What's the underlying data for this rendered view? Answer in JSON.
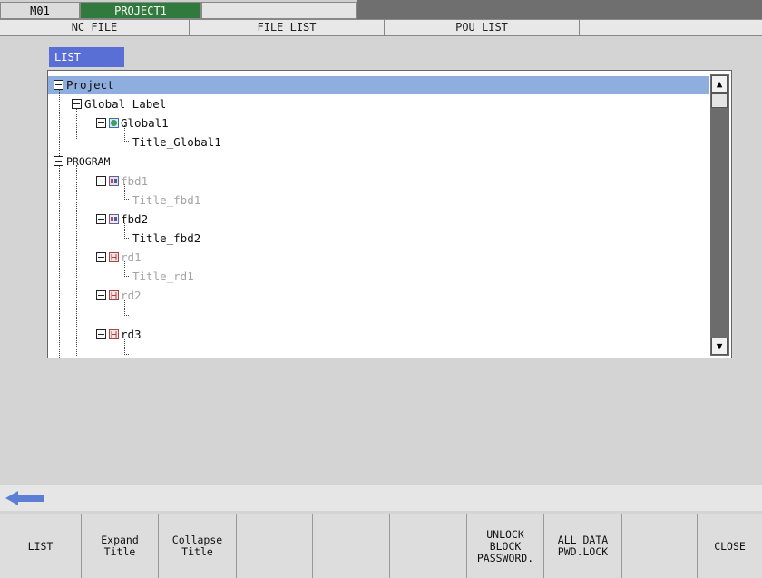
{
  "header": {
    "machine": "M01",
    "project": "PROJECT1"
  },
  "tabs": [
    "NC FILE",
    "FILE LIST",
    "POU LIST"
  ],
  "list_label": "LIST",
  "tree": [
    {
      "label": "Project"
    },
    {
      "label": "Global Label"
    },
    {
      "label": "Global1"
    },
    {
      "label": "Title_Global1"
    },
    {
      "label": "PROGRAM"
    },
    {
      "label": "fbd1"
    },
    {
      "label": "Title_fbd1"
    },
    {
      "label": "fbd2"
    },
    {
      "label": "Title_fbd2"
    },
    {
      "label": "rd1"
    },
    {
      "label": "Title_rd1"
    },
    {
      "label": "rd2"
    },
    {
      "label": "rd3"
    }
  ],
  "scroll": {
    "up": "▲",
    "down": "▼"
  },
  "fkeys": [
    "LIST",
    "Expand\nTitle",
    "Collapse\nTitle",
    "",
    "",
    "",
    "UNLOCK\nBLOCK\nPASSWORD.",
    "ALL DATA\nPWD.LOCK",
    "",
    "CLOSE"
  ]
}
